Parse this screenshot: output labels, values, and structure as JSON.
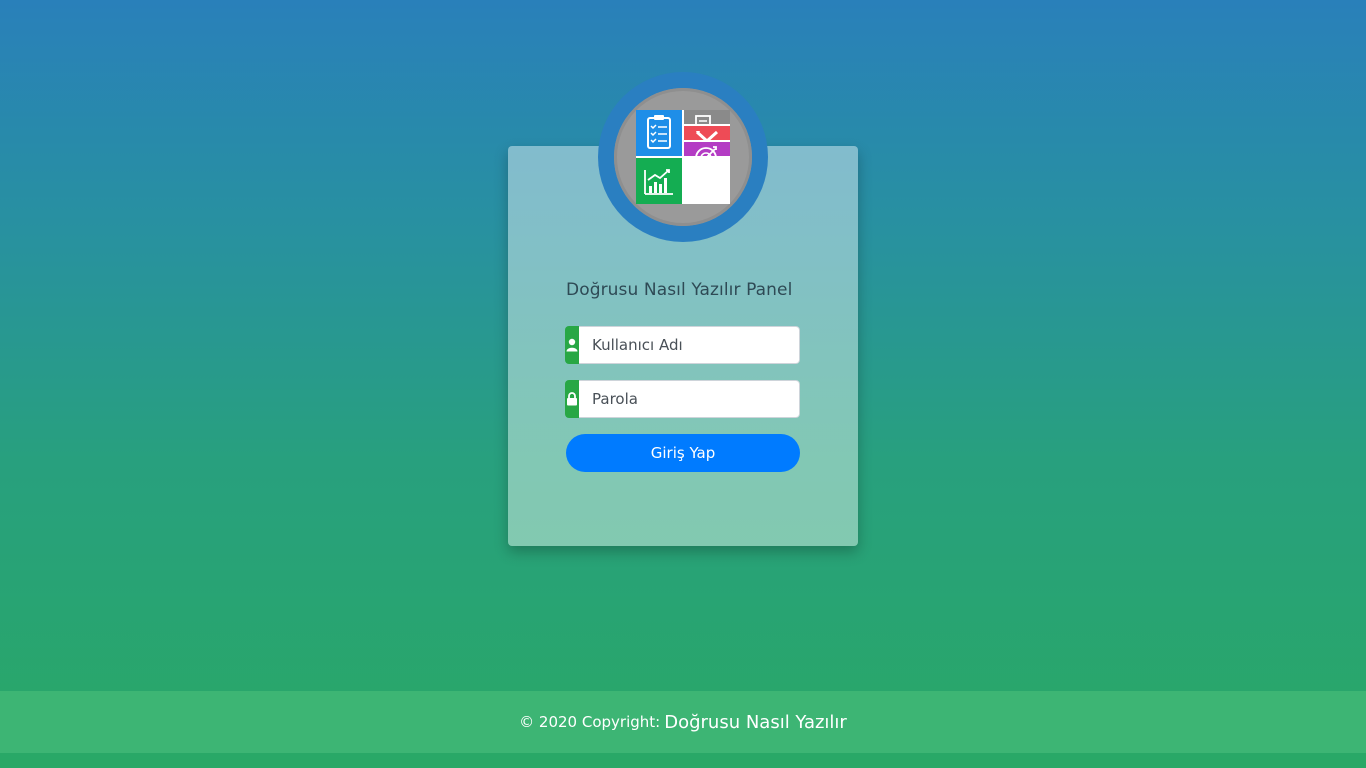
{
  "logo": {
    "icons": [
      "clipboard-checklist-icon",
      "document-search-icon",
      "ruler-pencil-icon",
      "growth-chart-icon",
      "target-icon"
    ],
    "colors": {
      "ring": "#2a7fc1",
      "blue": "#1e8ee8",
      "gray": "#8a8a8a",
      "red": "#ee4b56",
      "green": "#14ad52",
      "purple": "#b43cc4"
    }
  },
  "login": {
    "title": "Doğrusu Nasıl Yazılır Panel",
    "username_placeholder": "Kullanıcı Adı",
    "password_placeholder": "Parola",
    "submit_label": "Giriş Yap",
    "username_icon": "user-icon",
    "password_icon": "lock-icon"
  },
  "footer": {
    "copyright": "© 2020 Copyright:",
    "brand": "Doğrusu Nasıl Yazılır"
  },
  "colors": {
    "accent": "#007bff",
    "addon": "#28a745",
    "footer": "#3db574"
  }
}
